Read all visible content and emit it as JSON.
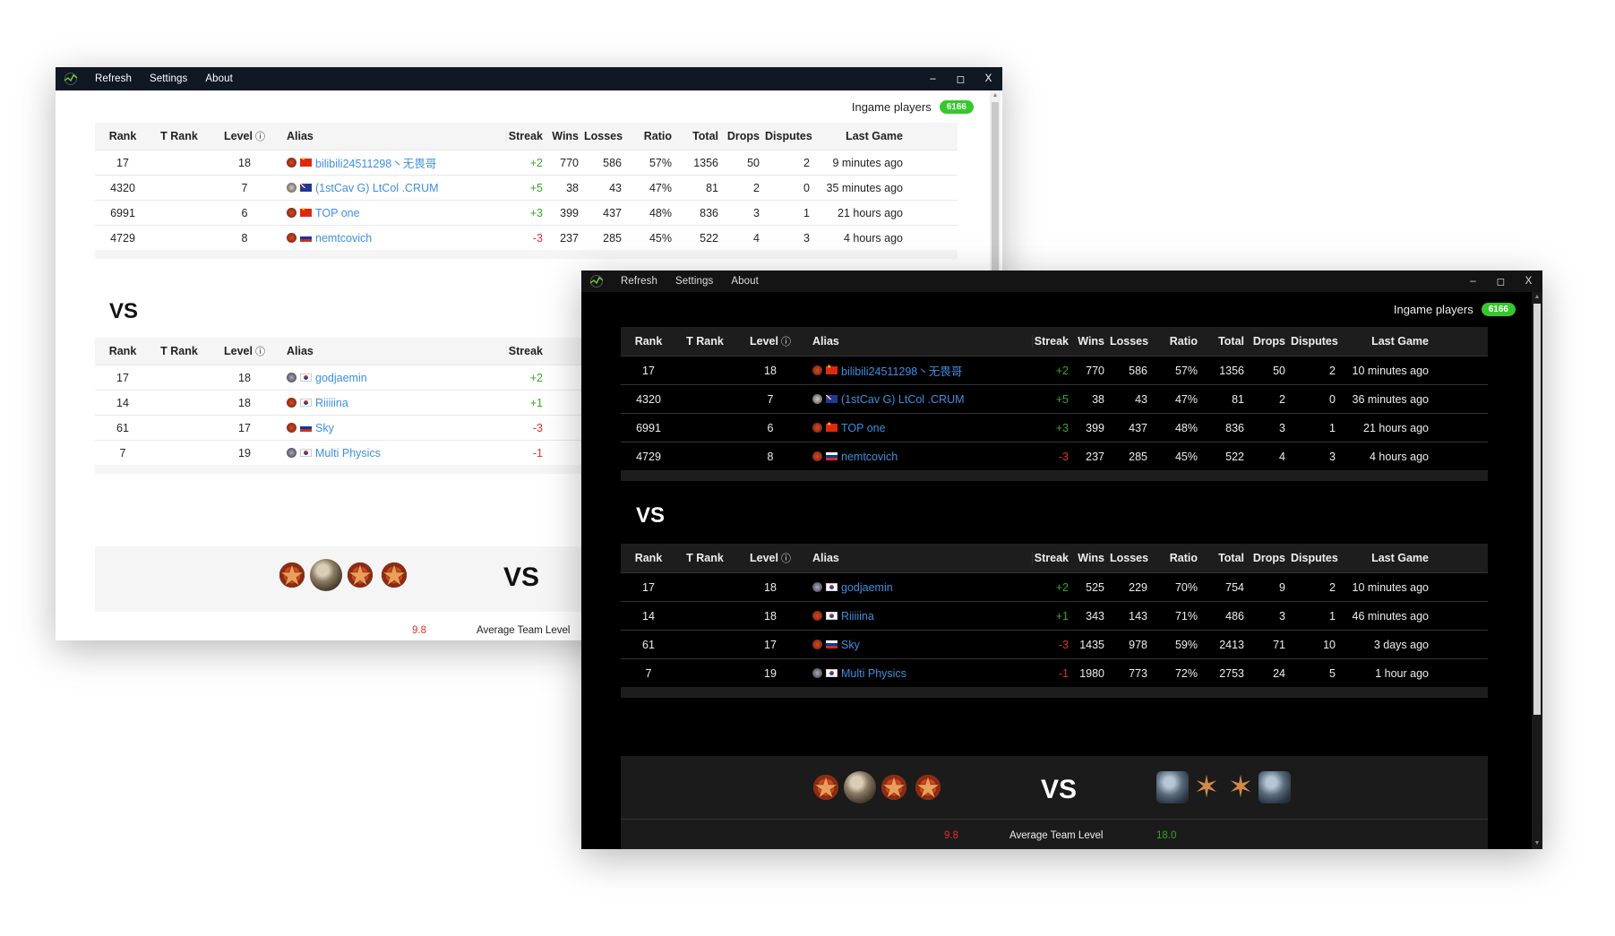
{
  "app": {
    "menu": [
      "Refresh",
      "Settings",
      "About"
    ],
    "controls": [
      "–",
      "◻",
      "X"
    ],
    "ingame_label": "Ingame players",
    "ingame_count": "6166"
  },
  "columns": [
    "Rank",
    "T Rank",
    "Level",
    "Alias",
    "Streak",
    "Wins",
    "Losses",
    "Ratio",
    "Total",
    "Drops",
    "Disputes",
    "Last Game"
  ],
  "vs_label": "VS",
  "avg_label": "Average Team Level",
  "colors": {
    "link": "#3d8fe0",
    "positive": "#3aa52b",
    "negative": "#e03030",
    "badge": "#36c82c"
  },
  "light": {
    "team1": [
      {
        "rank": "17",
        "trank": "",
        "level": "18",
        "emblem": "star-emblem",
        "flag": "cn",
        "alias": "bilibili24511298丶无畏哥",
        "streak": "+2",
        "wins": "770",
        "losses": "586",
        "ratio": "57%",
        "total": "1356",
        "drops": "50",
        "disputes": "2",
        "last": "9 minutes ago"
      },
      {
        "rank": "4320",
        "trank": "",
        "level": "7",
        "emblem": "round-emblem",
        "flag": "au",
        "alias": "(1stCav G) LtCol .CRUM",
        "streak": "+5",
        "wins": "38",
        "losses": "43",
        "ratio": "47%",
        "total": "81",
        "drops": "2",
        "disputes": "0",
        "last": "35 minutes ago"
      },
      {
        "rank": "6991",
        "trank": "",
        "level": "6",
        "emblem": "star-emblem",
        "flag": "cn",
        "alias": "TOP one",
        "streak": "+3",
        "wins": "399",
        "losses": "437",
        "ratio": "48%",
        "total": "836",
        "drops": "3",
        "disputes": "1",
        "last": "21 hours ago"
      },
      {
        "rank": "4729",
        "trank": "",
        "level": "8",
        "emblem": "star-emblem",
        "flag": "ru",
        "alias": "nemtcovich",
        "streak": "-3",
        "wins": "237",
        "losses": "285",
        "ratio": "45%",
        "total": "522",
        "drops": "4",
        "disputes": "3",
        "last": "4 hours ago"
      }
    ],
    "team2": [
      {
        "rank": "17",
        "trank": "",
        "level": "18",
        "emblem": "steel-emblem",
        "flag": "kr",
        "alias": "godjaemin",
        "streak": "+2"
      },
      {
        "rank": "14",
        "trank": "",
        "level": "18",
        "emblem": "star-emblem",
        "flag": "kr",
        "alias": "Riiiiina",
        "streak": "+1"
      },
      {
        "rank": "61",
        "trank": "",
        "level": "17",
        "emblem": "star-emblem",
        "flag": "ru",
        "alias": "Sky",
        "streak": "-3"
      },
      {
        "rank": "7",
        "trank": "",
        "level": "19",
        "emblem": "steel-emblem",
        "flag": "kr",
        "alias": "Multi Physics",
        "streak": "-1"
      }
    ],
    "avg1": "9.8"
  },
  "dark": {
    "team1": [
      {
        "rank": "17",
        "trank": "",
        "level": "18",
        "emblem": "star-emblem",
        "flag": "cn",
        "alias": "bilibili24511298丶无畏哥",
        "streak": "+2",
        "wins": "770",
        "losses": "586",
        "ratio": "57%",
        "total": "1356",
        "drops": "50",
        "disputes": "2",
        "last": "10 minutes ago"
      },
      {
        "rank": "4320",
        "trank": "",
        "level": "7",
        "emblem": "round-emblem",
        "flag": "au",
        "alias": "(1stCav G) LtCol .CRUM",
        "streak": "+5",
        "wins": "38",
        "losses": "43",
        "ratio": "47%",
        "total": "81",
        "drops": "2",
        "disputes": "0",
        "last": "36 minutes ago"
      },
      {
        "rank": "6991",
        "trank": "",
        "level": "6",
        "emblem": "star-emblem",
        "flag": "cn",
        "alias": "TOP one",
        "streak": "+3",
        "wins": "399",
        "losses": "437",
        "ratio": "48%",
        "total": "836",
        "drops": "3",
        "disputes": "1",
        "last": "21 hours ago"
      },
      {
        "rank": "4729",
        "trank": "",
        "level": "8",
        "emblem": "star-emblem",
        "flag": "ru",
        "alias": "nemtcovich",
        "streak": "-3",
        "wins": "237",
        "losses": "285",
        "ratio": "45%",
        "total": "522",
        "drops": "4",
        "disputes": "3",
        "last": "4 hours ago"
      }
    ],
    "team2": [
      {
        "rank": "17",
        "trank": "",
        "level": "18",
        "emblem": "steel-emblem",
        "flag": "kr",
        "alias": "godjaemin",
        "streak": "+2",
        "wins": "525",
        "losses": "229",
        "ratio": "70%",
        "total": "754",
        "drops": "9",
        "disputes": "2",
        "last": "10 minutes ago"
      },
      {
        "rank": "14",
        "trank": "",
        "level": "18",
        "emblem": "star-emblem",
        "flag": "kr",
        "alias": "Riiiiina",
        "streak": "+1",
        "wins": "343",
        "losses": "143",
        "ratio": "71%",
        "total": "486",
        "drops": "3",
        "disputes": "1",
        "last": "46 minutes ago"
      },
      {
        "rank": "61",
        "trank": "",
        "level": "17",
        "emblem": "star-emblem",
        "flag": "ru",
        "alias": "Sky",
        "streak": "-3",
        "wins": "1435",
        "losses": "978",
        "ratio": "59%",
        "total": "2413",
        "drops": "71",
        "disputes": "10",
        "last": "3 days ago"
      },
      {
        "rank": "7",
        "trank": "",
        "level": "19",
        "emblem": "steel-emblem",
        "flag": "kr",
        "alias": "Multi Physics",
        "streak": "-1",
        "wins": "1980",
        "losses": "773",
        "ratio": "72%",
        "total": "2753",
        "drops": "24",
        "disputes": "5",
        "last": "1 hour ago"
      }
    ],
    "avg1": "9.8",
    "avg2": "18.0"
  }
}
